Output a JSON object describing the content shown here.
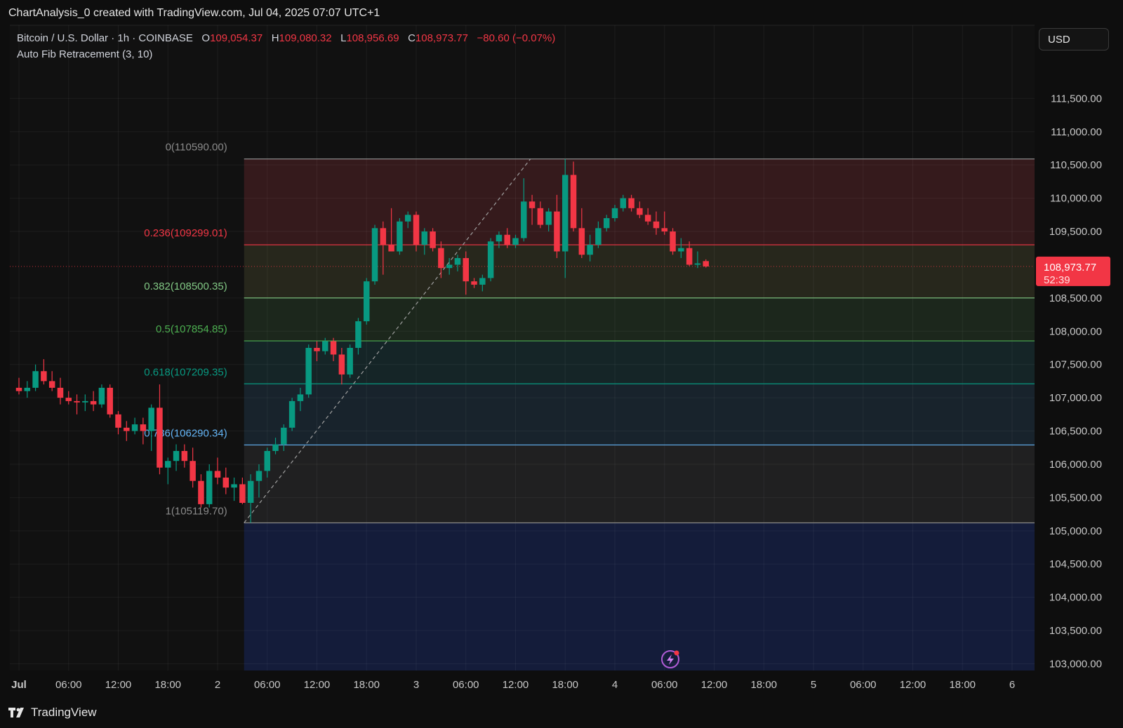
{
  "header": {
    "created_by": "ChartAnalysis_0 created with TradingView.com, Jul 04, 2025 07:07 UTC+1"
  },
  "legend": {
    "symbol": "Bitcoin / U.S. Dollar · 1h · COINBASE",
    "o_label": "O",
    "o_value": "109,054.37",
    "h_label": "H",
    "h_value": "109,080.32",
    "l_label": "L",
    "l_value": "108,956.69",
    "c_label": "C",
    "c_value": "108,973.77",
    "change": "−80.60 (−0.07%)",
    "indicator": "Auto Fib Retracement (3, 10)"
  },
  "currency_button": "USD",
  "footer": {
    "brand": "TradingView"
  },
  "colors": {
    "background": "#0e0e0e",
    "up": "#089981",
    "down": "#f23645",
    "price_tag": "#f23645"
  },
  "chart_data": {
    "type": "candlestick",
    "ylim": [
      102900,
      112600
    ],
    "y_ticks": [
      {
        "value": 111500,
        "label": "111,500.00"
      },
      {
        "value": 111000,
        "label": "111,000.00"
      },
      {
        "value": 110500,
        "label": "110,500.00"
      },
      {
        "value": 110000,
        "label": "110,000.00"
      },
      {
        "value": 109500,
        "label": "109,500.00"
      },
      {
        "value": 108500,
        "label": "108,500.00"
      },
      {
        "value": 108000,
        "label": "108,000.00"
      },
      {
        "value": 107500,
        "label": "107,500.00"
      },
      {
        "value": 107000,
        "label": "107,000.00"
      },
      {
        "value": 106500,
        "label": "106,500.00"
      },
      {
        "value": 106000,
        "label": "106,000.00"
      },
      {
        "value": 105500,
        "label": "105,500.00"
      },
      {
        "value": 105000,
        "label": "105,000.00"
      },
      {
        "value": 104500,
        "label": "104,500.00"
      },
      {
        "value": 104000,
        "label": "104,000.00"
      },
      {
        "value": 103500,
        "label": "103,500.00"
      },
      {
        "value": 103000,
        "label": "103,000.00"
      }
    ],
    "x_ticks": [
      {
        "hour": 0,
        "label": "Jul"
      },
      {
        "hour": 6,
        "label": "06:00"
      },
      {
        "hour": 12,
        "label": "12:00"
      },
      {
        "hour": 18,
        "label": "18:00"
      },
      {
        "hour": 24,
        "label": "2"
      },
      {
        "hour": 30,
        "label": "06:00"
      },
      {
        "hour": 36,
        "label": "12:00"
      },
      {
        "hour": 42,
        "label": "18:00"
      },
      {
        "hour": 48,
        "label": "3"
      },
      {
        "hour": 54,
        "label": "06:00"
      },
      {
        "hour": 60,
        "label": "12:00"
      },
      {
        "hour": 66,
        "label": "18:00"
      },
      {
        "hour": 72,
        "label": "4"
      },
      {
        "hour": 78,
        "label": "06:00"
      },
      {
        "hour": 84,
        "label": "12:00"
      },
      {
        "hour": 90,
        "label": "18:00"
      },
      {
        "hour": 96,
        "label": "5"
      },
      {
        "hour": 102,
        "label": "06:00"
      },
      {
        "hour": 108,
        "label": "12:00"
      },
      {
        "hour": 114,
        "label": "18:00"
      },
      {
        "hour": 120,
        "label": "6"
      }
    ],
    "last_price": {
      "value": 108973.77,
      "label": "108,973.77",
      "countdown": "52:39"
    },
    "fib_levels": [
      {
        "ratio": 0,
        "price": 110590.0,
        "label": "0(110590.00)",
        "color": "#8a8a8a",
        "fill": "#3a1c1e"
      },
      {
        "ratio": 0.236,
        "price": 109299.01,
        "label": "0.236(109299.01)",
        "color": "#f23645",
        "fill": "#2a2a1e"
      },
      {
        "ratio": 0.382,
        "price": 108500.35,
        "label": "0.382(108500.35)",
        "color": "#81c784",
        "fill": "#1e2a1e"
      },
      {
        "ratio": 0.5,
        "price": 107854.85,
        "label": "0.5(107854.85)",
        "color": "#4caf50",
        "fill": "#16282a"
      },
      {
        "ratio": 0.618,
        "price": 107209.35,
        "label": "0.618(107209.35)",
        "color": "#089981",
        "fill": "#1a2630"
      },
      {
        "ratio": 0.786,
        "price": 106290.34,
        "label": "0.786(106290.34)",
        "color": "#64b5f6",
        "fill": "#222224"
      },
      {
        "ratio": 1,
        "price": 105119.7,
        "label": "1(105119.70)",
        "color": "#8a8a8a",
        "fill": "#141c3a"
      }
    ],
    "fib_start_hour": 27.2,
    "trend_line": {
      "from": {
        "hour": 27.2,
        "price": 105119.7
      },
      "to": {
        "hour": 61.8,
        "price": 110590.0
      }
    },
    "candles": [
      {
        "o": 107150,
        "h": 107300,
        "l": 107050,
        "c": 107100
      },
      {
        "o": 107100,
        "h": 107250,
        "l": 107000,
        "c": 107150
      },
      {
        "o": 107150,
        "h": 107500,
        "l": 107100,
        "c": 107400
      },
      {
        "o": 107400,
        "h": 107580,
        "l": 107200,
        "c": 107250
      },
      {
        "o": 107250,
        "h": 107400,
        "l": 107100,
        "c": 107150
      },
      {
        "o": 107150,
        "h": 107300,
        "l": 106900,
        "c": 107000
      },
      {
        "o": 107000,
        "h": 107100,
        "l": 106900,
        "c": 106950
      },
      {
        "o": 106950,
        "h": 107050,
        "l": 106750,
        "c": 106930
      },
      {
        "o": 106930,
        "h": 107050,
        "l": 106800,
        "c": 106950
      },
      {
        "o": 106950,
        "h": 107100,
        "l": 106800,
        "c": 106900
      },
      {
        "o": 106900,
        "h": 107200,
        "l": 106850,
        "c": 107150
      },
      {
        "o": 107150,
        "h": 107200,
        "l": 106700,
        "c": 106750
      },
      {
        "o": 106750,
        "h": 106800,
        "l": 106450,
        "c": 106550
      },
      {
        "o": 106550,
        "h": 106650,
        "l": 106350,
        "c": 106500
      },
      {
        "o": 106500,
        "h": 106700,
        "l": 106450,
        "c": 106600
      },
      {
        "o": 106600,
        "h": 106700,
        "l": 106300,
        "c": 106500
      },
      {
        "o": 106500,
        "h": 106900,
        "l": 106200,
        "c": 106850
      },
      {
        "o": 106850,
        "h": 107200,
        "l": 105850,
        "c": 105950
      },
      {
        "o": 105950,
        "h": 106100,
        "l": 105700,
        "c": 106050
      },
      {
        "o": 106050,
        "h": 106300,
        "l": 105900,
        "c": 106200
      },
      {
        "o": 106200,
        "h": 106300,
        "l": 105950,
        "c": 106050
      },
      {
        "o": 106050,
        "h": 106250,
        "l": 105650,
        "c": 105750
      },
      {
        "o": 105750,
        "h": 105850,
        "l": 105350,
        "c": 105400
      },
      {
        "o": 105400,
        "h": 106000,
        "l": 105350,
        "c": 105900
      },
      {
        "o": 105900,
        "h": 106100,
        "l": 105700,
        "c": 105800
      },
      {
        "o": 105800,
        "h": 105950,
        "l": 105550,
        "c": 105650
      },
      {
        "o": 105650,
        "h": 105800,
        "l": 105450,
        "c": 105700
      },
      {
        "o": 105700,
        "h": 105800,
        "l": 105400,
        "c": 105420
      },
      {
        "o": 105420,
        "h": 105850,
        "l": 105120,
        "c": 105750
      },
      {
        "o": 105750,
        "h": 106000,
        "l": 105500,
        "c": 105900
      },
      {
        "o": 105900,
        "h": 106250,
        "l": 105800,
        "c": 106200
      },
      {
        "o": 106200,
        "h": 106400,
        "l": 106150,
        "c": 106300
      },
      {
        "o": 106300,
        "h": 106600,
        "l": 106200,
        "c": 106550
      },
      {
        "o": 106550,
        "h": 107000,
        "l": 106500,
        "c": 106950
      },
      {
        "o": 106950,
        "h": 107150,
        "l": 106800,
        "c": 107050
      },
      {
        "o": 107050,
        "h": 107800,
        "l": 107000,
        "c": 107750
      },
      {
        "o": 107750,
        "h": 107850,
        "l": 107550,
        "c": 107700
      },
      {
        "o": 107700,
        "h": 107900,
        "l": 107650,
        "c": 107850
      },
      {
        "o": 107850,
        "h": 107900,
        "l": 107550,
        "c": 107650
      },
      {
        "o": 107650,
        "h": 107750,
        "l": 107200,
        "c": 107350
      },
      {
        "o": 107350,
        "h": 107800,
        "l": 107300,
        "c": 107750
      },
      {
        "o": 107750,
        "h": 108200,
        "l": 107650,
        "c": 108150
      },
      {
        "o": 108150,
        "h": 108800,
        "l": 108100,
        "c": 108750
      },
      {
        "o": 108750,
        "h": 109600,
        "l": 108700,
        "c": 109550
      },
      {
        "o": 109550,
        "h": 109650,
        "l": 108850,
        "c": 109300
      },
      {
        "o": 109300,
        "h": 109850,
        "l": 109200,
        "c": 109200
      },
      {
        "o": 109200,
        "h": 109700,
        "l": 109150,
        "c": 109650
      },
      {
        "o": 109650,
        "h": 109800,
        "l": 109550,
        "c": 109750
      },
      {
        "o": 109750,
        "h": 109800,
        "l": 109200,
        "c": 109300
      },
      {
        "o": 109300,
        "h": 109550,
        "l": 109150,
        "c": 109500
      },
      {
        "o": 109500,
        "h": 109550,
        "l": 109200,
        "c": 109250
      },
      {
        "o": 109250,
        "h": 109350,
        "l": 108800,
        "c": 108950
      },
      {
        "o": 108950,
        "h": 109100,
        "l": 108850,
        "c": 109000
      },
      {
        "o": 109000,
        "h": 109150,
        "l": 108900,
        "c": 109100
      },
      {
        "o": 109100,
        "h": 109200,
        "l": 108550,
        "c": 108750
      },
      {
        "o": 108750,
        "h": 108800,
        "l": 108650,
        "c": 108700
      },
      {
        "o": 108700,
        "h": 108850,
        "l": 108600,
        "c": 108800
      },
      {
        "o": 108800,
        "h": 109400,
        "l": 108750,
        "c": 109350
      },
      {
        "o": 109350,
        "h": 109500,
        "l": 109250,
        "c": 109450
      },
      {
        "o": 109450,
        "h": 109550,
        "l": 109250,
        "c": 109300
      },
      {
        "o": 109300,
        "h": 109450,
        "l": 109250,
        "c": 109400
      },
      {
        "o": 109400,
        "h": 110300,
        "l": 109350,
        "c": 109950
      },
      {
        "o": 109950,
        "h": 110050,
        "l": 109600,
        "c": 109850
      },
      {
        "o": 109850,
        "h": 109950,
        "l": 109550,
        "c": 109600
      },
      {
        "o": 109600,
        "h": 109850,
        "l": 109500,
        "c": 109800
      },
      {
        "o": 109800,
        "h": 110050,
        "l": 109100,
        "c": 109200
      },
      {
        "o": 109200,
        "h": 110590,
        "l": 108800,
        "c": 110350
      },
      {
        "o": 110350,
        "h": 110550,
        "l": 109500,
        "c": 109550
      },
      {
        "o": 109550,
        "h": 109850,
        "l": 109100,
        "c": 109150
      },
      {
        "o": 109150,
        "h": 109450,
        "l": 109050,
        "c": 109300
      },
      {
        "o": 109300,
        "h": 109650,
        "l": 109250,
        "c": 109550
      },
      {
        "o": 109550,
        "h": 109750,
        "l": 109500,
        "c": 109700
      },
      {
        "o": 109700,
        "h": 109900,
        "l": 109650,
        "c": 109850
      },
      {
        "o": 109850,
        "h": 110050,
        "l": 109800,
        "c": 110000
      },
      {
        "o": 110000,
        "h": 110050,
        "l": 109800,
        "c": 109850
      },
      {
        "o": 109850,
        "h": 109950,
        "l": 109700,
        "c": 109750
      },
      {
        "o": 109750,
        "h": 109850,
        "l": 109600,
        "c": 109650
      },
      {
        "o": 109650,
        "h": 109800,
        "l": 109450,
        "c": 109550
      },
      {
        "o": 109550,
        "h": 109800,
        "l": 109450,
        "c": 109500
      },
      {
        "o": 109500,
        "h": 109550,
        "l": 109150,
        "c": 109200
      },
      {
        "o": 109200,
        "h": 109400,
        "l": 109100,
        "c": 109250
      },
      {
        "o": 109250,
        "h": 109350,
        "l": 108980,
        "c": 109000
      },
      {
        "o": 109000,
        "h": 109200,
        "l": 108950,
        "c": 109020
      },
      {
        "o": 109054.37,
        "h": 109080.32,
        "l": 108956.69,
        "c": 108973.77
      }
    ]
  }
}
